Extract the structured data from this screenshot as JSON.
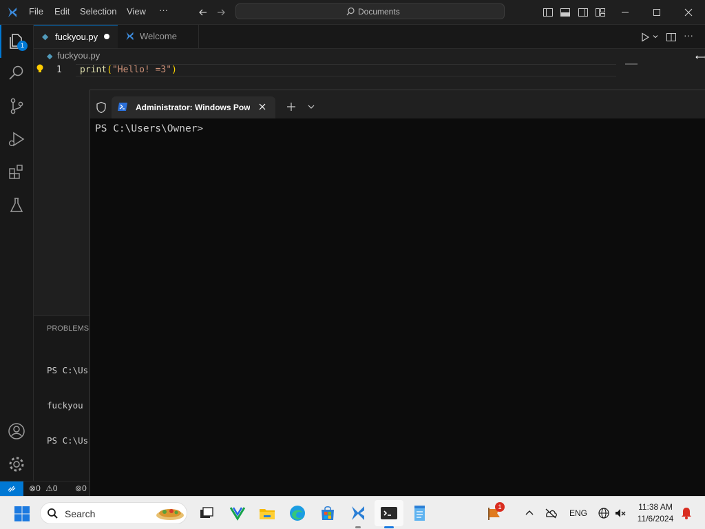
{
  "menu": [
    "File",
    "Edit",
    "Selection",
    "View",
    "···"
  ],
  "command_center": {
    "placeholder": "Documents"
  },
  "activity": {
    "explorer_badge": "1"
  },
  "tabs": [
    {
      "label": "fuckyou.py",
      "modified": true
    },
    {
      "label": "Welcome"
    }
  ],
  "editor": {
    "breadcrumb": "fuckyou.py",
    "line_number": "1",
    "code_fn": "print",
    "code_open": "(",
    "code_string": "\"Hello! =3\"",
    "code_close": ")"
  },
  "panel": {
    "title": "PROBLEMS",
    "lines": [
      "PS C:\\Us",
      "fuckyou",
      "PS C:\\Us"
    ]
  },
  "status": {
    "errors": "0",
    "warnings": "0",
    "ports": "0"
  },
  "terminal": {
    "tab_title": "Administrator: Windows Powe",
    "prompt": "PS C:\\Users\\Owner>"
  },
  "taskbar": {
    "search_placeholder": "Search",
    "notification_badge": "1",
    "language": "ENG",
    "time": "11:38 AM",
    "date": "11/6/2024"
  },
  "colors": {
    "accent": "#0078d4",
    "remote": "#0078d4",
    "string": "#ce9178",
    "function": "#dcdcaa",
    "bulb": "#ffcc00",
    "badge_red": "#d92d20"
  }
}
